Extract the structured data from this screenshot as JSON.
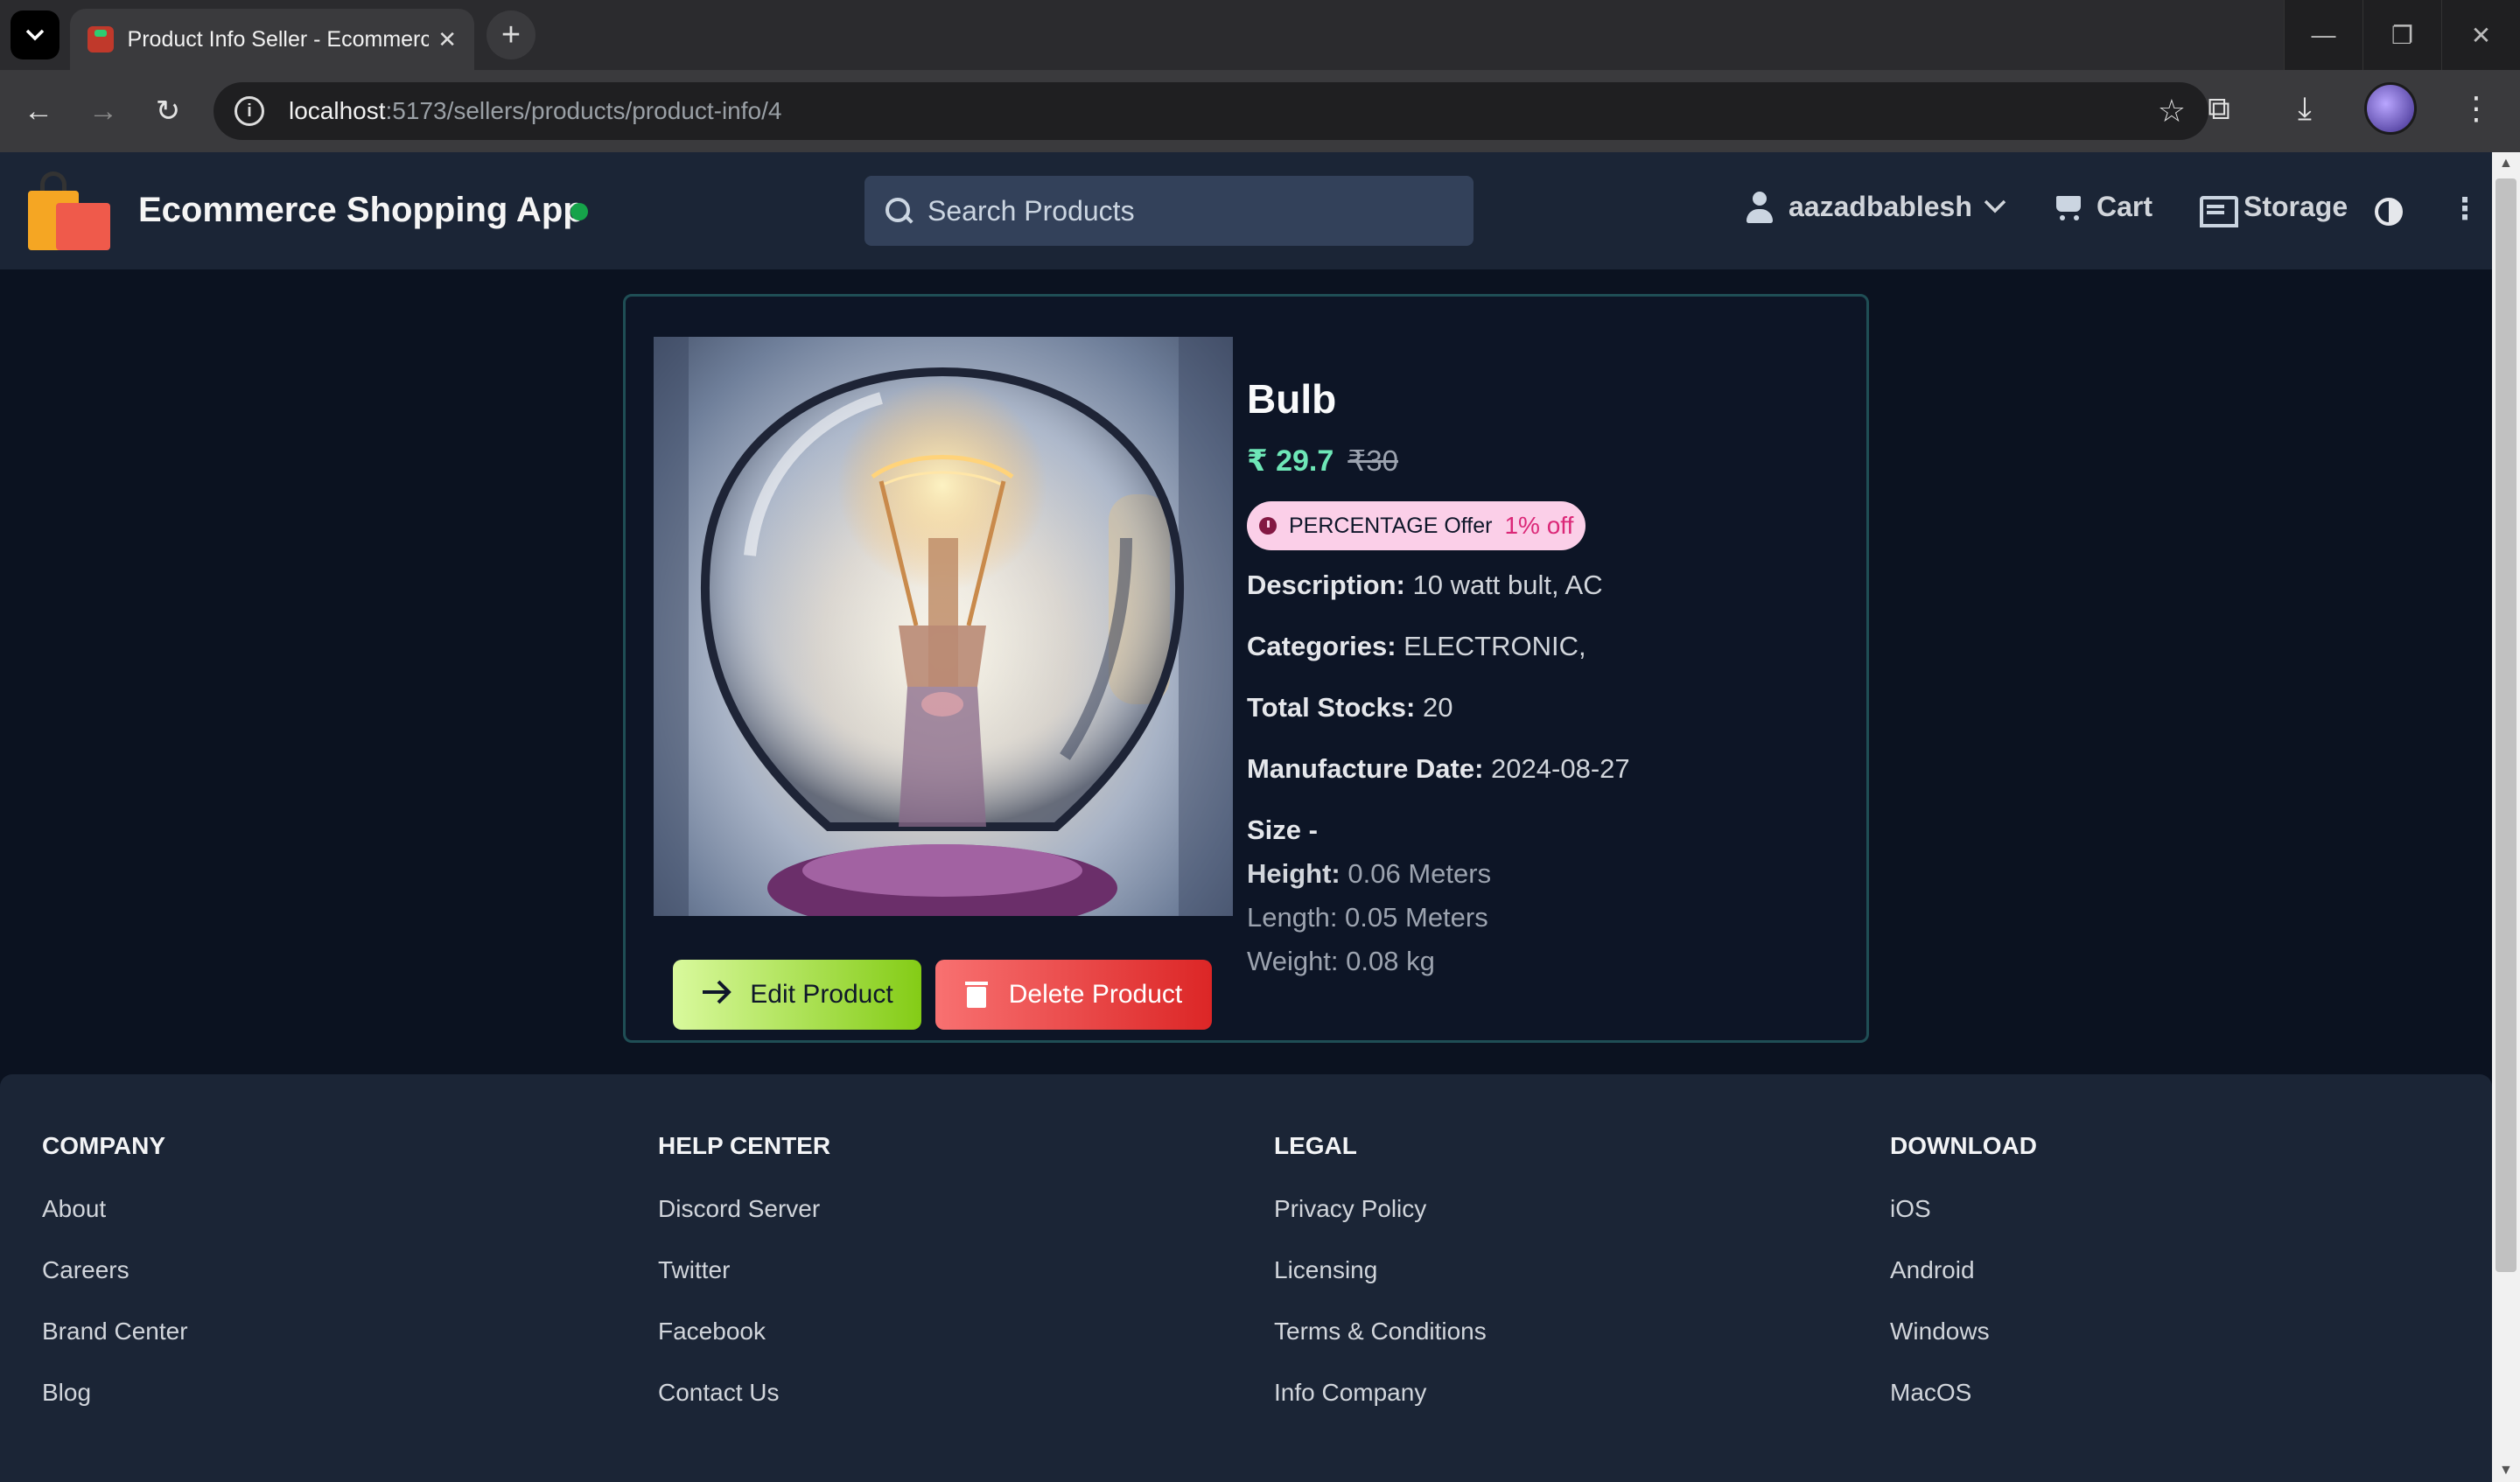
{
  "browser": {
    "tab_title": "Product Info Seller - Ecommerce Shopping App",
    "url_host": "localhost",
    "url_path": ":5173/sellers/products/product-info/4"
  },
  "header": {
    "app_title": "Ecommerce Shopping App",
    "search_placeholder": "Search Products",
    "username": "aazadbablesh",
    "cart_label": "Cart",
    "storage_label": "Storage"
  },
  "product": {
    "name": "Bulb",
    "price": "₹ 29.7",
    "mrp": "₹30",
    "offer_type": "PERCENTAGE Offer",
    "offer_value": "1% off",
    "description_label": "Description:",
    "description": " 10 watt bult, AC",
    "categories_label": "Categories:",
    "categories": " ELECTRONIC,",
    "stocks_label": "Total Stocks:",
    "stocks": " 20",
    "mfg_label": "Manufacture Date:",
    "mfg_date": " 2024-08-27",
    "size_label": "Size -",
    "height_label": "Height:",
    "height": " 0.06 Meters",
    "length": "Length: 0.05 Meters",
    "weight": "Weight: 0.08 kg",
    "edit_label": "Edit Product",
    "delete_label": "Delete Product"
  },
  "footer": {
    "company": {
      "heading": "COMPANY",
      "links": [
        "About",
        "Careers",
        "Brand Center",
        "Blog"
      ]
    },
    "help": {
      "heading": "HELP CENTER",
      "links": [
        "Discord Server",
        "Twitter",
        "Facebook",
        "Contact Us"
      ]
    },
    "legal": {
      "heading": "LEGAL",
      "links": [
        "Privacy Policy",
        "Licensing",
        "Terms & Conditions",
        "Info Company"
      ]
    },
    "download": {
      "heading": "DOWNLOAD",
      "links": [
        "iOS",
        "Android",
        "Windows",
        "MacOS"
      ]
    }
  },
  "colors": {
    "price": "#6ee7b7",
    "offer_bg": "#fbcfe8",
    "edit_button": "#84cc16",
    "delete_button": "#dc2626"
  }
}
